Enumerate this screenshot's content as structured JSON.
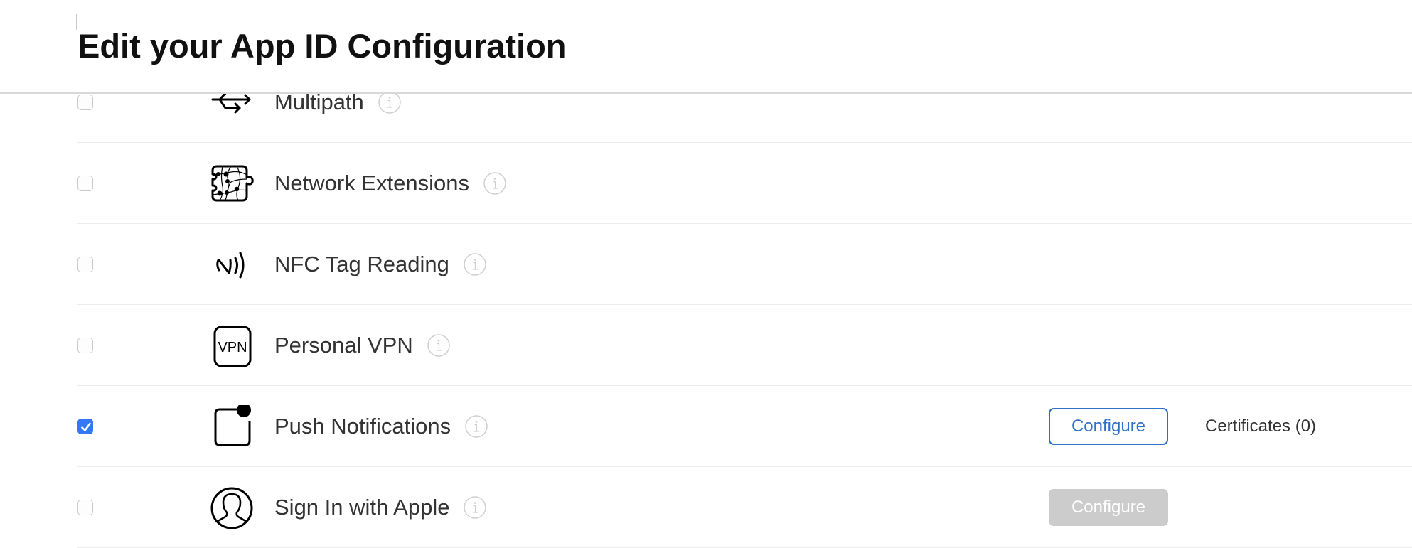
{
  "header": {
    "title": "Edit your App ID Configuration"
  },
  "capabilities": [
    {
      "name": "Multipath",
      "icon": "multipath-icon",
      "checked": false
    },
    {
      "name": "Network Extensions",
      "icon": "network-extensions-icon",
      "checked": false
    },
    {
      "name": "NFC Tag Reading",
      "icon": "nfc-icon",
      "checked": false
    },
    {
      "name": "Personal VPN",
      "icon": "vpn-icon",
      "icon_text": "VPN",
      "checked": false
    },
    {
      "name": "Push Notifications",
      "icon": "push-notifications-icon",
      "checked": true,
      "configure_label": "Configure",
      "configure_enabled": true,
      "certificates_label": "Certificates (0)"
    },
    {
      "name": "Sign In with Apple",
      "icon": "person-circle-icon",
      "checked": false,
      "configure_label": "Configure",
      "configure_enabled": false
    }
  ],
  "colors": {
    "accent": "#2e6fc8",
    "checkbox_checked": "#3478f6",
    "disabled_button": "#cccccc",
    "info_icon": "#cfcfcf"
  }
}
